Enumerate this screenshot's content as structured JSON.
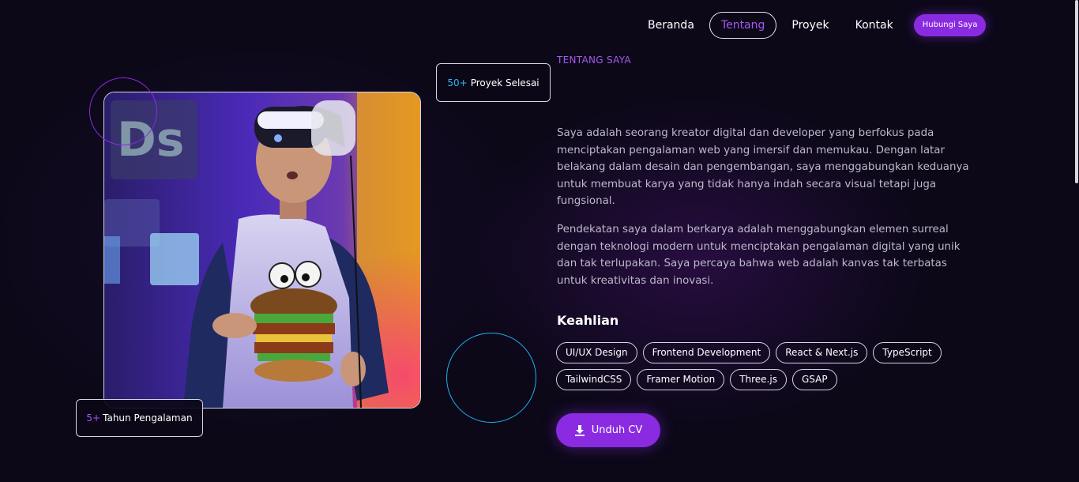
{
  "nav": {
    "items": [
      {
        "label": "Beranda"
      },
      {
        "label": "Tentang",
        "active": true
      },
      {
        "label": "Proyek"
      },
      {
        "label": "Kontak"
      }
    ],
    "cta_label": "Hubungi Saya"
  },
  "stats": {
    "projects_number": "50+",
    "projects_label": "Proyek Selesai",
    "years_number": "5+",
    "years_label": "Tahun Pengalaman"
  },
  "about": {
    "section_label": "TENTANG SAYA",
    "paragraph1": "Saya adalah seorang kreator digital dan developer yang berfokus pada menciptakan pengalaman web yang imersif dan memukau. Dengan latar belakang dalam desain dan pengembangan, saya menggabungkan keduanya untuk membuat karya yang tidak hanya indah secara visual tetapi juga fungsional.",
    "paragraph2": "Pendekatan saya dalam berkarya adalah menggabungkan elemen surreal dengan teknologi modern untuk menciptakan pengalaman digital yang unik dan tak terlupakan. Saya percaya bahwa web adalah kanvas tak terbatas untuk kreativitas dan inovasi."
  },
  "skills": {
    "title": "Keahlian",
    "row1": [
      "UI/UX Design",
      "Frontend Development",
      "React & Next.js",
      "TypeScript"
    ],
    "row2": [
      "TailwindCSS",
      "Framer Motion",
      "Three.js",
      "GSAP"
    ]
  },
  "download": {
    "label": "Unduh CV",
    "icon": "download-icon"
  },
  "photo": {
    "subject": "vr-headset-person-photo"
  },
  "colors": {
    "accent": "#8a2be2",
    "accent_text": "#a459f0",
    "cyan": "#2cb8ef",
    "background": "#0c0818"
  }
}
